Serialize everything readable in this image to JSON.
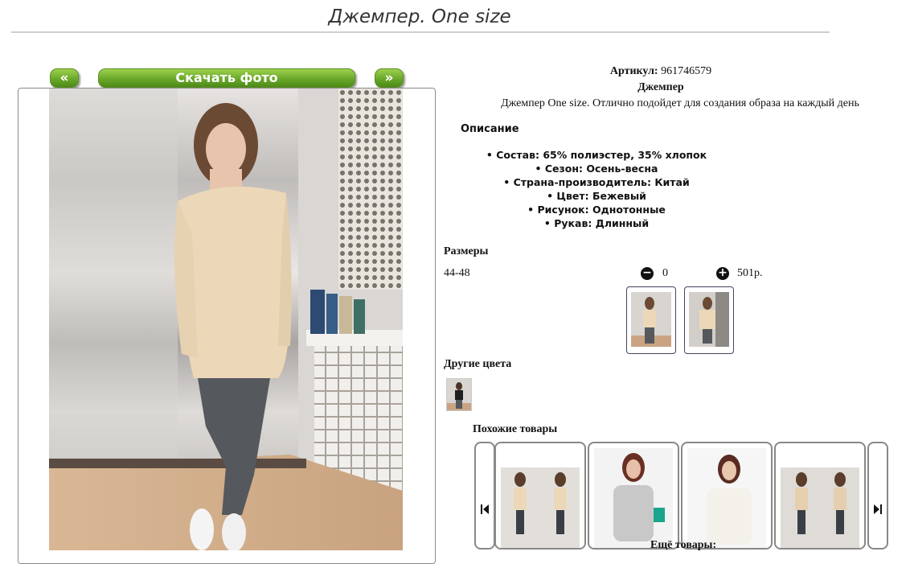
{
  "page": {
    "title": "Джемпер. One size"
  },
  "gallery": {
    "prev_label": "«",
    "download_label": "Скачать фото",
    "next_label": "»"
  },
  "product": {
    "article_label": "Артикул:",
    "article_value": "961746579",
    "name": "Джемпер",
    "short_description": "Джемпер One size. Отлично подойдет для создания образа на каждый день",
    "description_heading": "Описание",
    "properties": [
      "Состав: 65% полиэстер, 35% хлопок",
      "Сезон: Осень-весна",
      "Страна-производитель: Китай",
      "Цвет: Бежевый",
      "Рисунок: Однотонные",
      "Рукав: Длинный"
    ]
  },
  "sizes": {
    "heading": "Размеры",
    "size": "44-48",
    "quantity": "0",
    "price": "501р."
  },
  "other_colors": {
    "heading": "Другие цвета"
  },
  "similar": {
    "heading": "Похожие товары",
    "more_label": "Ещё товары:"
  },
  "colors": {
    "accent_green": "#6aa82a",
    "border_blue": "#446"
  },
  "icons": [
    "minus-circle-icon",
    "plus-circle-icon",
    "skip-back-icon",
    "skip-forward-icon"
  ]
}
